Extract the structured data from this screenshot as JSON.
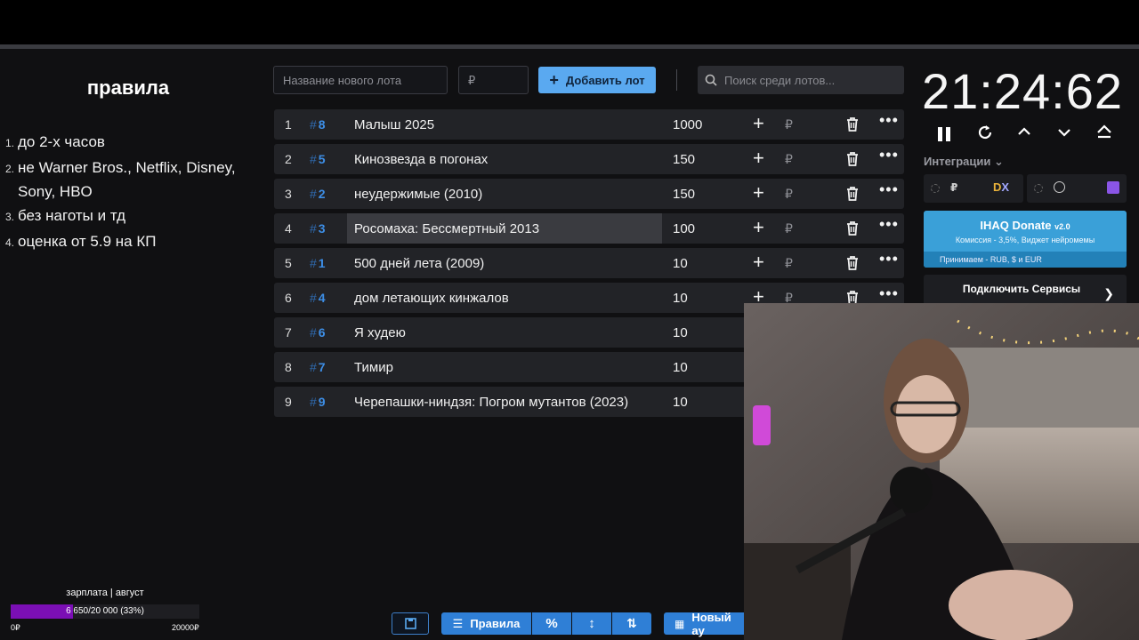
{
  "rules": {
    "title": "правила",
    "items": [
      {
        "num": "1.",
        "text": "до 2-х часов"
      },
      {
        "num": "2.",
        "text": "не Warner Bros., Netflix, Disney, Sony, HBO"
      },
      {
        "num": "3.",
        "text": "без наготы и тд"
      },
      {
        "num": "4.",
        "text": "оценка от 5.9 на КП"
      }
    ]
  },
  "salary": {
    "label": "зарплата | август",
    "bar_text": "6 650/20 000 (33%)",
    "progress_percent": 33,
    "min": "0₽",
    "max": "20000₽",
    "color": "#7b0fb5"
  },
  "toolbar_top": {
    "lot_name_placeholder": "Название нового лота",
    "amount_placeholder": "₽",
    "add_label": "Добавить лот",
    "search_placeholder": "Поиск среди лотов..."
  },
  "lots": [
    {
      "idx": "1",
      "id": "8",
      "name": "Малыш 2025",
      "amount": "1000",
      "highlight": false
    },
    {
      "idx": "2",
      "id": "5",
      "name": "Кинозвезда в погонах",
      "amount": "150",
      "highlight": false
    },
    {
      "idx": "3",
      "id": "2",
      "name": "неудержимые (2010)",
      "amount": "150",
      "highlight": false
    },
    {
      "idx": "4",
      "id": "3",
      "name": "Росомаха: Бессмертный 2013",
      "amount": "100",
      "highlight": true
    },
    {
      "idx": "5",
      "id": "1",
      "name": "500 дней лета (2009)",
      "amount": "10",
      "highlight": false
    },
    {
      "idx": "6",
      "id": "4",
      "name": "дом летающих кинжалов",
      "amount": "10",
      "highlight": false
    },
    {
      "idx": "7",
      "id": "6",
      "name": "Я худею",
      "amount": "10",
      "highlight": false
    },
    {
      "idx": "8",
      "id": "7",
      "name": "Тимир",
      "amount": "10",
      "highlight": false
    },
    {
      "idx": "9",
      "id": "9",
      "name": "Черепашки-ниндзя: Погром мутантов (2023)",
      "amount": "10",
      "highlight": false
    }
  ],
  "timer": {
    "value": "21:24:62",
    "controls": [
      "pause-icon",
      "restart-icon",
      "chevron-up-icon",
      "chevron-down-icon",
      "eject-icon"
    ]
  },
  "integrations": {
    "label": "Интеграции",
    "donate_title": "IHAQ Donate",
    "donate_version": "v2.0",
    "donate_sub": "Комиссия - 3,5%, Виджет нейромемы",
    "donate_strip": "Принимаем - RUB, $ и EUR",
    "services_label": "Подключить Сервисы"
  },
  "toolbar_bottom": {
    "rules_label": "Правила",
    "new_auction_label": "Новый ау"
  },
  "colors": {
    "accent": "#2f7fd6",
    "add_button": "#5aa9f0",
    "id_blue": "#3d8ee6",
    "donate": "#3aa0d8"
  }
}
